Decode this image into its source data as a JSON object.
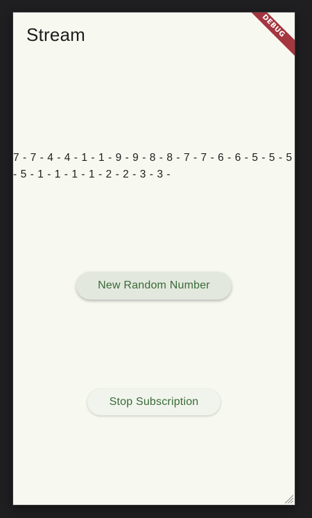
{
  "app": {
    "title": "Stream",
    "debug_banner": "DEBUG"
  },
  "stream": {
    "numbers_text": "7 - 7 - 4 - 4 - 1 - 1 - 9 - 9 - 8 - 8 - 7 - 7 - 6 - 6 - 5 - 5 - 5 - 5 - 1 - 1 - 1 - 1 - 2 - 2 - 3 - 3 -"
  },
  "buttons": {
    "new_random_label": "New Random Number",
    "stop_label": "Stop Subscription"
  },
  "colors": {
    "background": "#f7f9f1",
    "button_text": "#386a37",
    "debug_banner": "#a4363f"
  }
}
